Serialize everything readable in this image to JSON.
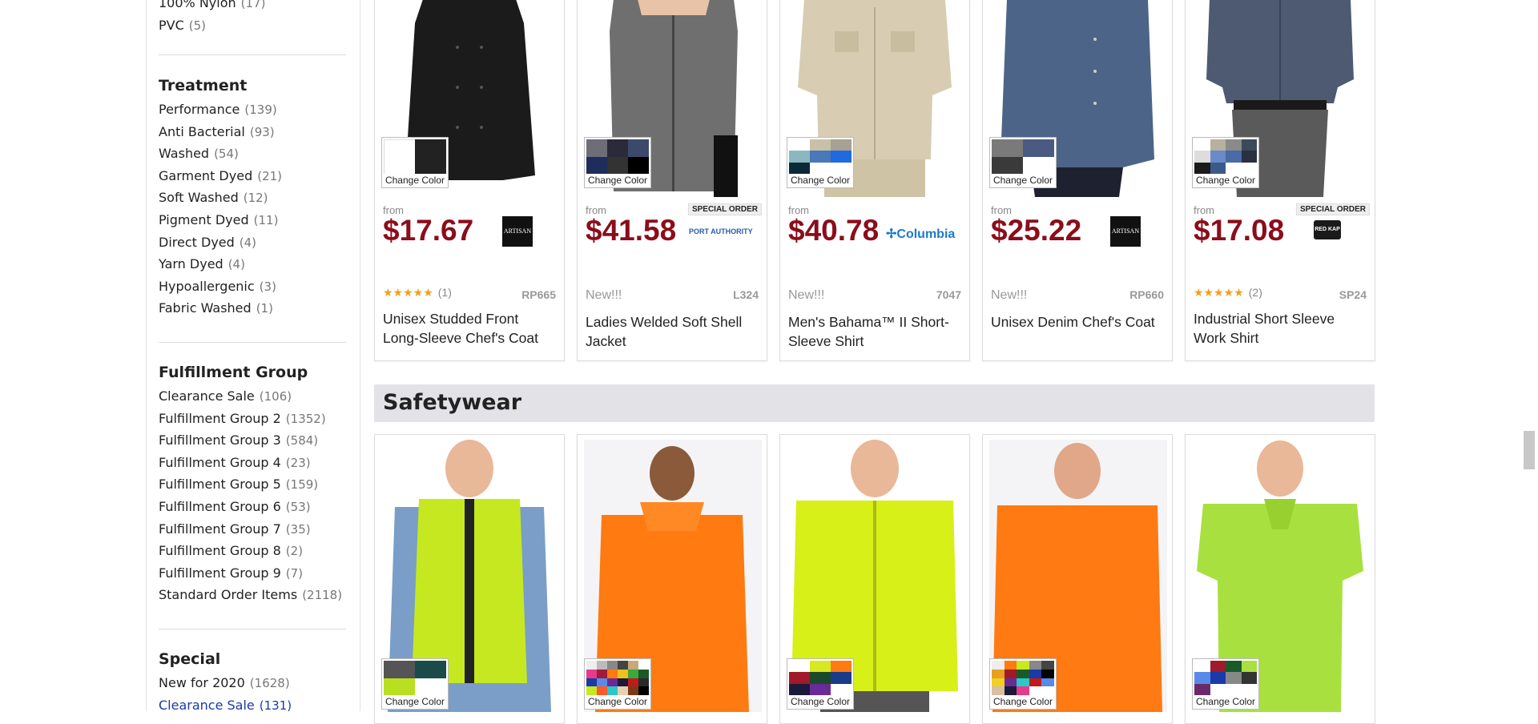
{
  "sidebar": {
    "top_items": [
      {
        "label": "100% Nylon",
        "count": "(17)"
      },
      {
        "label": "PVC",
        "count": "(5)"
      }
    ],
    "treatment": {
      "heading": "Treatment",
      "items": [
        {
          "label": "Performance",
          "count": "(139)"
        },
        {
          "label": "Anti Bacterial",
          "count": "(93)"
        },
        {
          "label": "Washed",
          "count": "(54)"
        },
        {
          "label": "Garment Dyed",
          "count": "(21)"
        },
        {
          "label": "Soft Washed",
          "count": "(12)"
        },
        {
          "label": "Pigment Dyed",
          "count": "(11)"
        },
        {
          "label": "Direct Dyed",
          "count": "(4)"
        },
        {
          "label": "Yarn Dyed",
          "count": "(4)"
        },
        {
          "label": "Hypoallergenic",
          "count": "(3)"
        },
        {
          "label": "Fabric Washed",
          "count": "(1)"
        }
      ]
    },
    "fulfillment": {
      "heading": "Fulfillment Group",
      "items": [
        {
          "label": "Clearance Sale",
          "count": "(106)"
        },
        {
          "label": "Fulfillment Group 2",
          "count": "(1352)"
        },
        {
          "label": "Fulfillment Group 3",
          "count": "(584)"
        },
        {
          "label": "Fulfillment Group 4",
          "count": "(23)"
        },
        {
          "label": "Fulfillment Group 5",
          "count": "(159)"
        },
        {
          "label": "Fulfillment Group 6",
          "count": "(53)"
        },
        {
          "label": "Fulfillment Group 7",
          "count": "(35)"
        },
        {
          "label": "Fulfillment Group 8",
          "count": "(2)"
        },
        {
          "label": "Fulfillment Group 9",
          "count": "(7)"
        },
        {
          "label": "Standard Order Items",
          "count": "(2118)"
        }
      ]
    },
    "special": {
      "heading": "Special",
      "items": [
        {
          "label": "New for 2020",
          "count": "(1628)"
        },
        {
          "label": "Clearance Sale",
          "count": "(131)"
        }
      ]
    }
  },
  "change_color_label": "Change Color",
  "from_label": "from",
  "special_order_label": "SPECIAL ORDER",
  "products_row1": [
    {
      "price": "$17.67",
      "brand": "ARTISAN",
      "rating_stars": "★★★★★",
      "rating_count": "(1)",
      "new": "",
      "sku": "RP665",
      "title": "Unisex Studded Front Long-Sleeve Chef's Coat",
      "special": false
    },
    {
      "price": "$41.58",
      "brand": "PORT AUTHORITY",
      "rating_stars": "",
      "rating_count": "",
      "new": "New!!!",
      "sku": "L324",
      "title": "Ladies Welded Soft Shell Jacket",
      "special": true
    },
    {
      "price": "$40.78",
      "brand": "Columbia",
      "rating_stars": "",
      "rating_count": "",
      "new": "New!!!",
      "sku": "7047",
      "title": "Men's Bahama™ II Short-Sleeve Shirt",
      "special": false
    },
    {
      "price": "$25.22",
      "brand": "ARTISAN",
      "rating_stars": "",
      "rating_count": "",
      "new": "New!!!",
      "sku": "RP660",
      "title": "Unisex Denim Chef's Coat",
      "special": false
    },
    {
      "price": "$17.08",
      "brand": "RED KAP",
      "rating_stars": "★★★★★",
      "rating_count": "(2)",
      "new": "",
      "sku": "SP24",
      "title": "Industrial Short Sleeve Work Shirt",
      "special": true
    }
  ],
  "section": {
    "title": "Safetywear"
  },
  "colors": {
    "price": "#8b0d1b",
    "section_bg": "#e3e3e7",
    "link": "#1a3aa8",
    "safety_yellow": "#c8e82a",
    "safety_orange": "#ff7a10"
  }
}
